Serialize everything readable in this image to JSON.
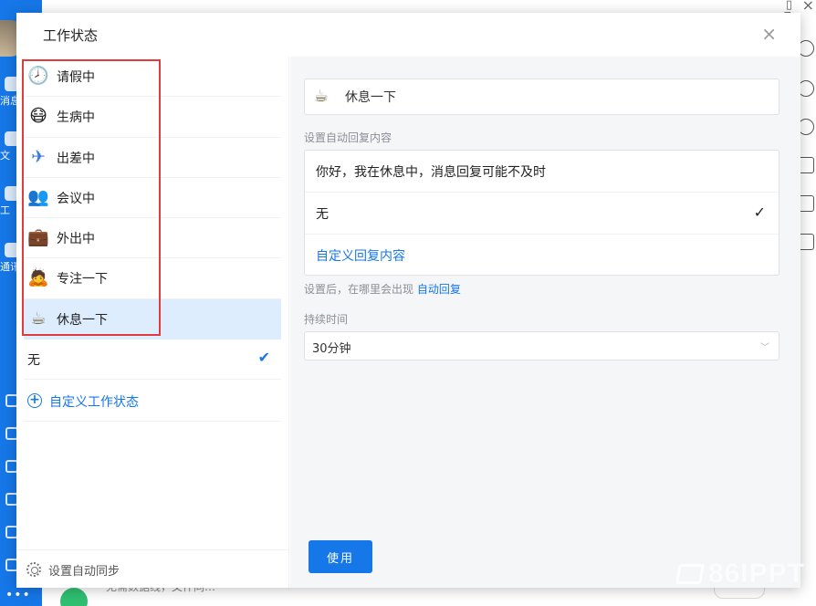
{
  "background": {
    "nav_labels": [
      "消息",
      "文",
      "工",
      "通讯"
    ],
    "bottom_text": "无需数据线，文件同…",
    "watermark": "86IPPT"
  },
  "dialog": {
    "title": "工作状态",
    "close": "×"
  },
  "statuses": [
    {
      "label": "请假中",
      "emoji": "🕗"
    },
    {
      "label": "生病中",
      "emoji": "😷"
    },
    {
      "label": "出差中",
      "emoji": "✈"
    },
    {
      "label": "会议中",
      "emoji": "👥"
    },
    {
      "label": "外出中",
      "emoji": "💼"
    },
    {
      "label": "专注一下",
      "emoji": "🙇"
    },
    {
      "label": "休息一下",
      "emoji": "☕"
    }
  ],
  "selected_status_index": 6,
  "none_option": {
    "label": "无",
    "check": "✔"
  },
  "custom_status": {
    "label": "自定义工作状态",
    "plus": "+"
  },
  "sync": {
    "label": "设置自动同步"
  },
  "editor": {
    "input_value": "休息一下",
    "input_emoji": "☕",
    "auto_reply_label": "设置自动回复内容",
    "reply_options": [
      {
        "label": "你好，我在休息中，消息回复可能不及时",
        "check": ""
      },
      {
        "label": "无",
        "check": "✓"
      },
      {
        "label": "自定义回复内容",
        "check": ""
      }
    ],
    "hint_prefix": "设置后，在哪里会出现",
    "hint_link": "自动回复",
    "duration_label": "持续时间",
    "duration_value": "30分钟",
    "use_button": "使用"
  },
  "colors": {
    "accent": "#1677e8",
    "highlight_box": "#e03c3c",
    "selected_row": "#deedfd"
  }
}
